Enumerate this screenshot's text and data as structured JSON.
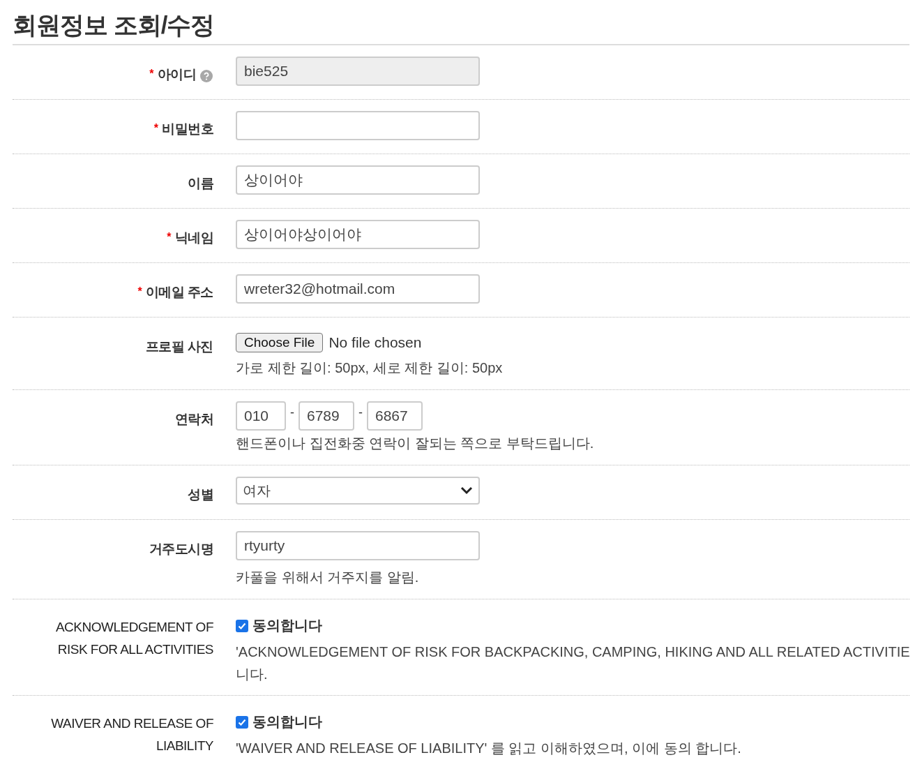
{
  "title": "회원정보 조회/수정",
  "fields": [
    {
      "kind": "text",
      "label": "아이디",
      "required_mark": "*",
      "help": true,
      "value": "bie525",
      "disabled": true
    },
    {
      "kind": "password",
      "label": "비밀번호",
      "required_mark": "*",
      "disabled": false
    },
    {
      "kind": "text",
      "label": "이름",
      "value": "상이어야",
      "disabled": false
    },
    {
      "kind": "text",
      "label": "닉네임",
      "required_mark": "*",
      "value": "상이어야상이어야",
      "disabled": false
    },
    {
      "kind": "text",
      "label": "이메일 주소",
      "required_mark": "*",
      "value": "wreter32@hotmail.com",
      "disabled": false
    },
    {
      "kind": "file",
      "label": "프로필 사진",
      "button": "Choose File",
      "status": "No file chosen",
      "notes": [
        "가로 제한 길이: 50px, 세로 제한 길이: 50px"
      ]
    },
    {
      "kind": "phone",
      "label": "연락처",
      "parts": [
        "010",
        "6789",
        "6867"
      ],
      "separator": "-",
      "notes": [
        "핸드폰이나 집전화중 연락이 잘되는 쪽으로 부탁드립니다."
      ]
    },
    {
      "kind": "select",
      "label": "성별",
      "value": "여자"
    },
    {
      "kind": "text",
      "label": "거주도시명",
      "value": "rtyurty",
      "disabled": false,
      "notes": [
        "카풀을 위해서 거주지를 알림."
      ]
    },
    {
      "kind": "checkbox",
      "label": "ACKNOWLEDGEMENT OF RISK FOR ALL ACTIVITIES",
      "checked": true,
      "option": "동의합니다",
      "notes": [
        "'ACKNOWLEDGEMENT OF RISK FOR BACKPACKING, CAMPING, HIKING AND ALL RELATED ACTIVITIE",
        "니다."
      ]
    },
    {
      "kind": "checkbox",
      "label": "WAIVER AND RELEASE OF LIABILITY",
      "checked": true,
      "option": "동의합니다",
      "notes": [
        "'WAIVER AND RELEASE OF LIABILITY' 를 읽고 이해하였으며, 이에 동의 합니다."
      ]
    }
  ]
}
